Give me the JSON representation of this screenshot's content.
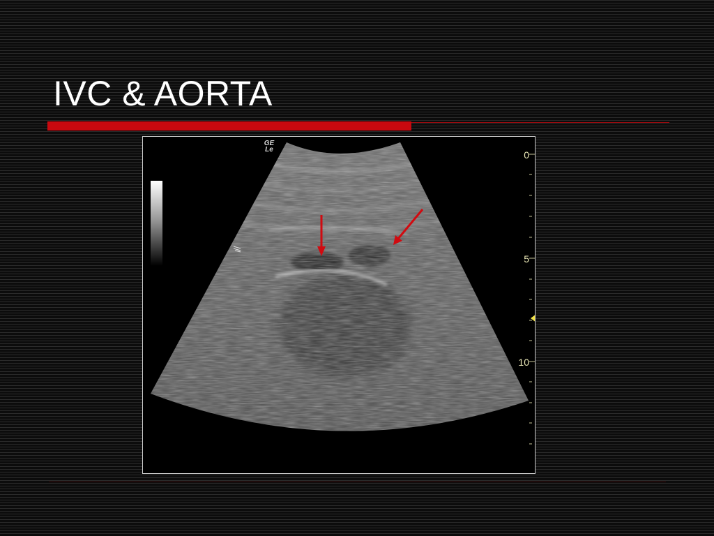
{
  "slide": {
    "title": "IVC & AORTA"
  },
  "ultrasound": {
    "vendor_mark": "GE",
    "vendor_sub": "Le",
    "depth_scale": {
      "labels": [
        "0",
        "5",
        "10"
      ]
    },
    "arrow_color": "#d10a10",
    "marker_color": "#f2e34a"
  },
  "colors": {
    "accent": "#c8090f",
    "background": "#121212",
    "title_text": "#ffffff",
    "scale_text": "#ece9b8"
  }
}
